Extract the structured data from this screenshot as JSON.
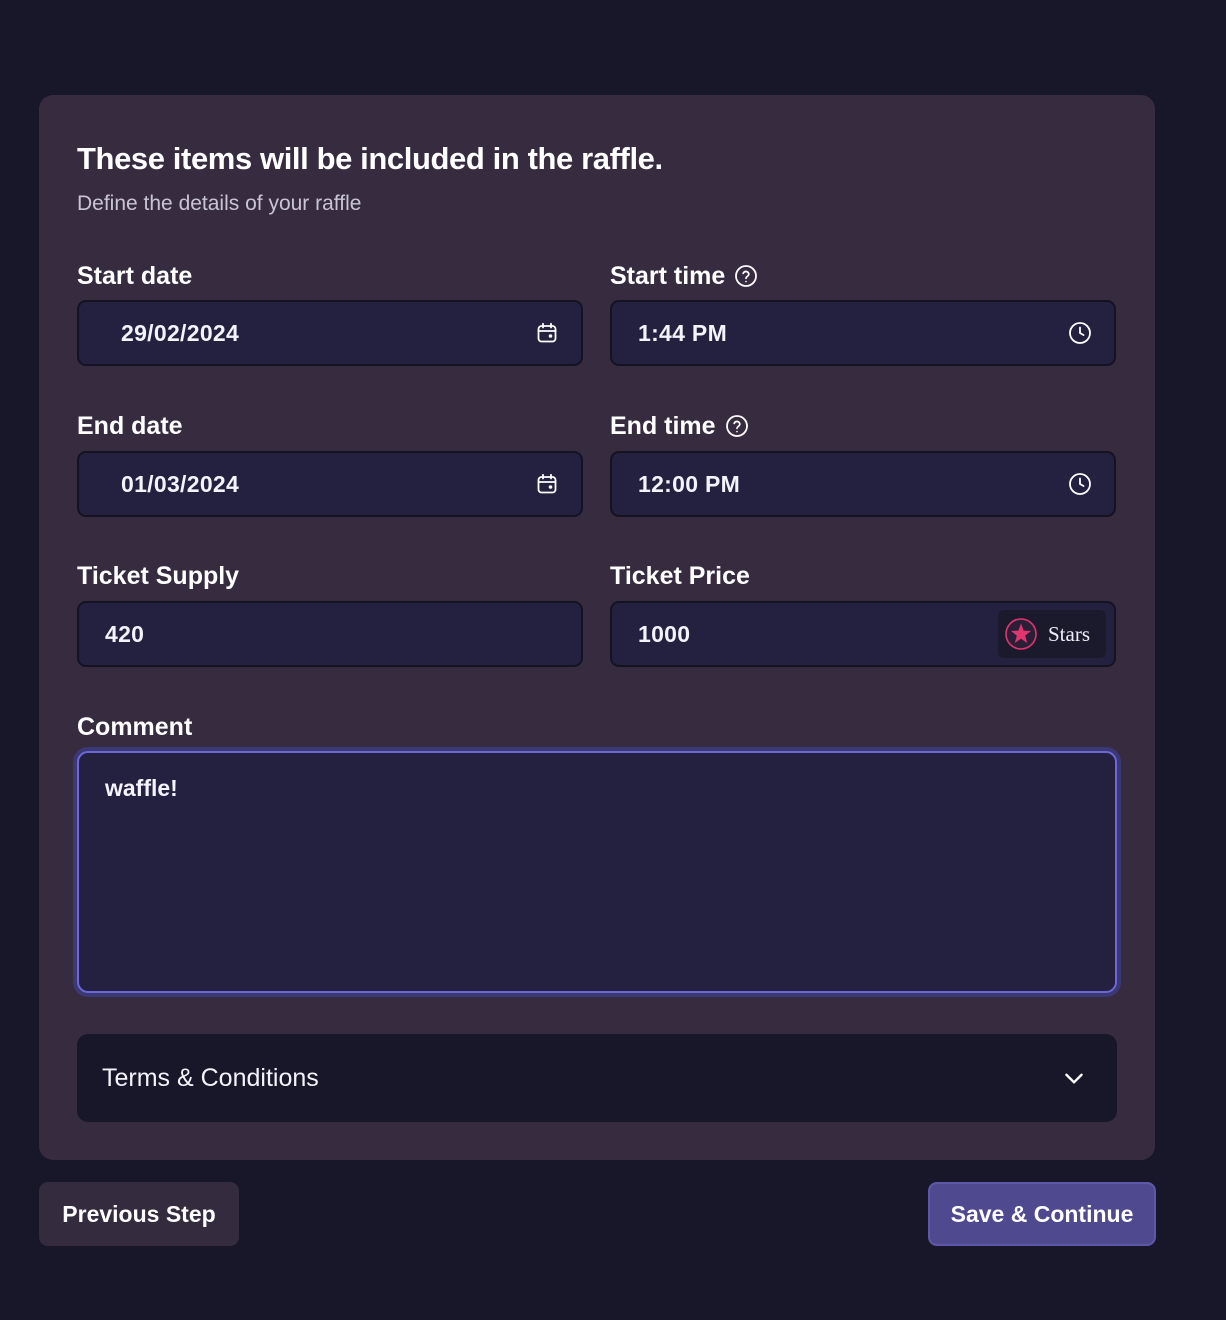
{
  "card": {
    "title": "These items will be included in the raffle.",
    "subtitle": "Define the details of your raffle"
  },
  "fields": {
    "start_date": {
      "label": "Start date",
      "value": "29/02/2024",
      "icon": "calendar-icon"
    },
    "start_time": {
      "label": "Start time",
      "value": "1:44 PM",
      "icon": "clock-icon",
      "help_icon": "question-circle-icon"
    },
    "end_date": {
      "label": "End date",
      "value": "01/03/2024",
      "icon": "calendar-icon"
    },
    "end_time": {
      "label": "End time",
      "value": "12:00 PM",
      "icon": "clock-icon",
      "help_icon": "question-circle-icon"
    },
    "ticket_supply": {
      "label": "Ticket Supply",
      "value": "420"
    },
    "ticket_price": {
      "label": "Ticket Price",
      "value": "1000",
      "currency": "Stars",
      "currency_icon": "star-icon"
    },
    "comment": {
      "label": "Comment",
      "value": "waffle!"
    }
  },
  "terms": {
    "label": "Terms & Conditions",
    "icon": "chevron-down-icon"
  },
  "buttons": {
    "previous": "Previous Step",
    "save": "Save & Continue"
  },
  "colors": {
    "background": "#18172a",
    "card": "#372b40",
    "input": "#232040",
    "focus_border": "#6d68d6",
    "primary_button": "#4f4a8f",
    "star_accent": "#e0356f"
  }
}
